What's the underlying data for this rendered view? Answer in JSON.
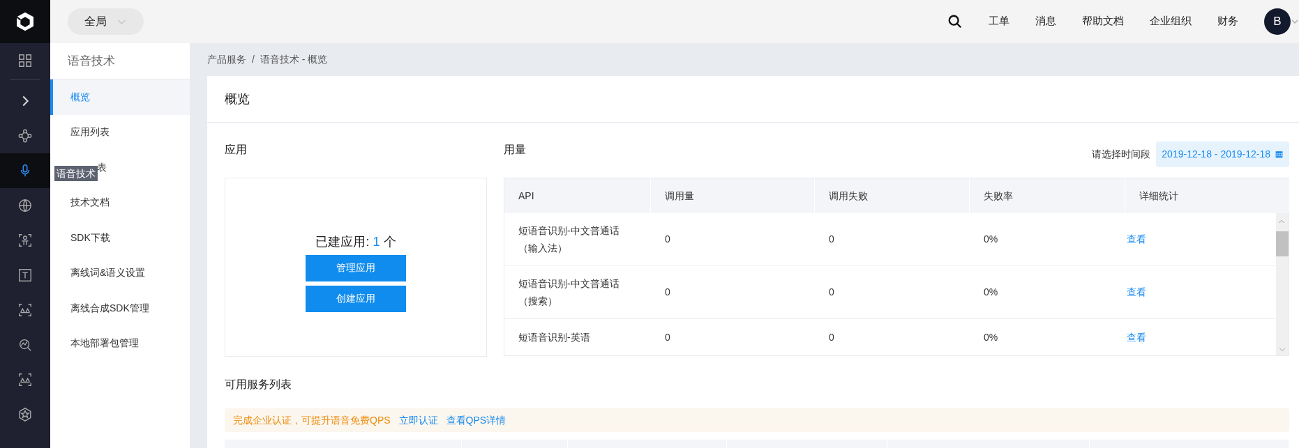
{
  "topbar": {
    "region": "全局",
    "links": [
      "工单",
      "消息",
      "帮助文档",
      "企业组织",
      "财务"
    ],
    "avatar": "B"
  },
  "rail": {
    "items": [
      {
        "kind": "grid",
        "selected": false
      },
      {
        "kind": "chevron",
        "selected": false
      },
      {
        "kind": "nodes",
        "selected": false
      },
      {
        "kind": "mic",
        "selected": true
      },
      {
        "kind": "globe",
        "selected": false
      },
      {
        "kind": "person",
        "selected": false
      },
      {
        "kind": "text",
        "selected": false
      },
      {
        "kind": "scan",
        "selected": false
      },
      {
        "kind": "chart",
        "selected": false
      },
      {
        "kind": "scan",
        "selected": false
      },
      {
        "kind": "star",
        "selected": false
      }
    ],
    "tooltip": "语音技术"
  },
  "sidebar": {
    "title": "语音技术",
    "items": [
      {
        "label": "概览",
        "selected": true,
        "covered": false
      },
      {
        "label": "应用列表",
        "selected": false,
        "covered": false
      },
      {
        "label": "表",
        "selected": false,
        "covered": true
      },
      {
        "label": "技术文档",
        "selected": false,
        "covered": false
      },
      {
        "label": "SDK下载",
        "selected": false,
        "covered": false
      },
      {
        "label": "离线词&语义设置",
        "selected": false,
        "covered": false
      },
      {
        "label": "离线合成SDK管理",
        "selected": false,
        "covered": false
      },
      {
        "label": "本地部署包管理",
        "selected": false,
        "covered": false
      }
    ]
  },
  "breadcrumb": [
    "产品服务",
    "语音技术 - 概览"
  ],
  "breadcrumb_separator": "/",
  "page_title": "概览",
  "apps": {
    "title": "应用",
    "count_label": "已建应用:",
    "count": "1",
    "unit": "个",
    "buttons": [
      "管理应用",
      "创建应用"
    ]
  },
  "usage": {
    "title": "用量",
    "date_label": "请选择时间段",
    "date_range": "2019-12-18 - 2019-12-18",
    "columns": [
      "API",
      "调用量",
      "调用失败",
      "失败率",
      "详细统计"
    ],
    "rows": [
      {
        "api": "短语音识别-中文普通话（输入法）",
        "calls": "0",
        "failed": "0",
        "rate": "0%",
        "link": "查看"
      },
      {
        "api": "短语音识别-中文普通话（搜索）",
        "calls": "0",
        "failed": "0",
        "rate": "0%",
        "link": "查看"
      },
      {
        "api": "短语音识别-英语",
        "calls": "0",
        "failed": "0",
        "rate": "0%",
        "link": "查看"
      }
    ]
  },
  "services": {
    "title": "可用服务列表",
    "notice": "完成企业认证，可提升语音免费QPS",
    "links": [
      "立即认证",
      "查看QPS详情"
    ]
  }
}
